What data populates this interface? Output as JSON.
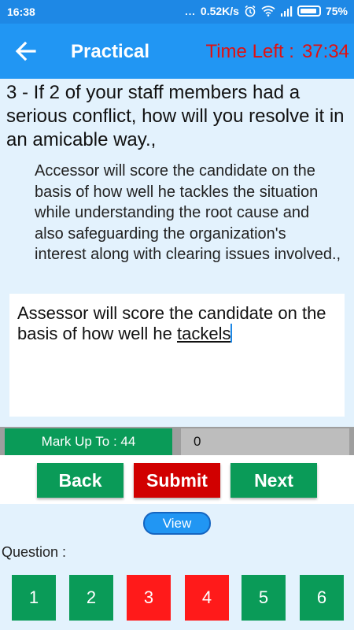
{
  "status_bar": {
    "time": "16:38",
    "dots": "...",
    "network_speed": "0.52K/s",
    "battery": "75%"
  },
  "app_bar": {
    "title": "Practical",
    "timer_label": "Time Left :",
    "timer_value": "37:34"
  },
  "question": {
    "text": "3 - If 2 of your staff members had a serious conflict, how will you resolve it in an amicable way.,",
    "model_answer": "Accessor will score the candidate on the basis of how well he tackles the situation while understanding the root cause and also safeguarding the organization's interest along with clearing issues involved.,"
  },
  "answer": {
    "text_before": "Assessor will score the candidate on the basis of how well he ",
    "misspelled_word": "tackels"
  },
  "marks": {
    "label": "Mark Up To : 44",
    "value": "0"
  },
  "actions": {
    "back": "Back",
    "submit": "Submit",
    "next": "Next",
    "view": "View"
  },
  "navigator": {
    "label": "Question :",
    "questions": [
      {
        "label": "1",
        "color": "#0a9b58"
      },
      {
        "label": "2",
        "color": "#0a9b58"
      },
      {
        "label": "3",
        "color": "#ff1a1a"
      },
      {
        "label": "4",
        "color": "#ff1a1a"
      },
      {
        "label": "5",
        "color": "#0a9b58"
      },
      {
        "label": "6",
        "color": "#0a9b58"
      }
    ]
  },
  "colors": {
    "app_bar": "#2196f3",
    "status_bar": "#1e88e5",
    "answered": "#0a9b58",
    "unanswered": "#ff1a1a",
    "timer": "#e01010"
  }
}
